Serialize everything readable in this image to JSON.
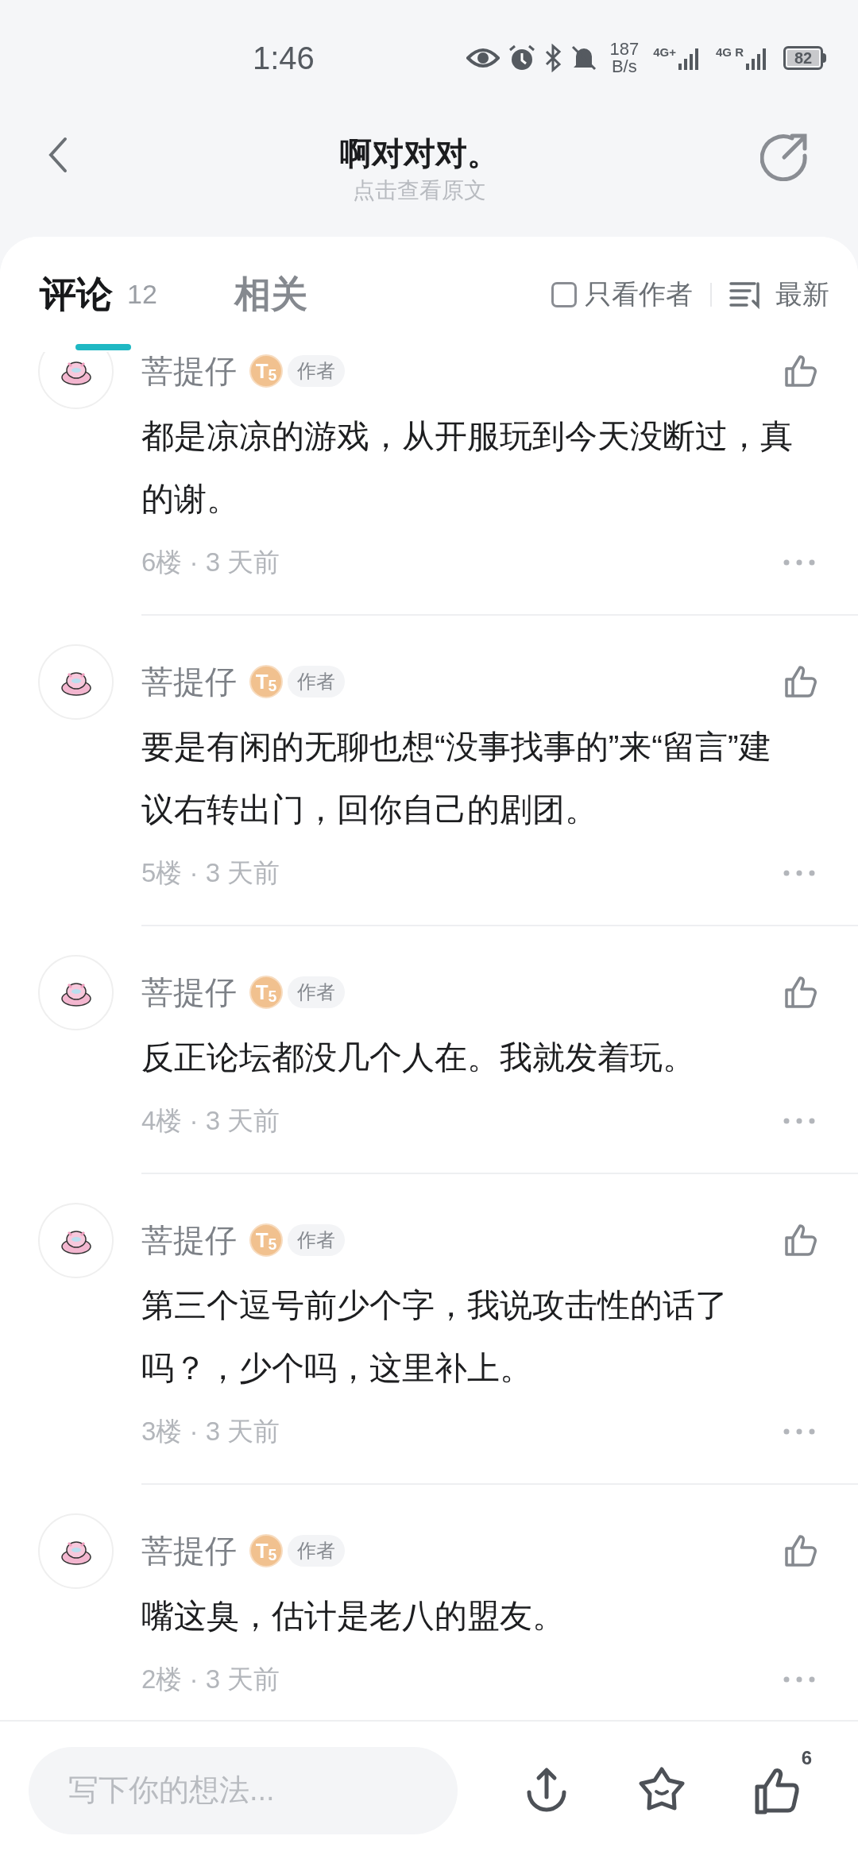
{
  "status_bar": {
    "time": "1:46",
    "net_speed": [
      "187",
      "B/s"
    ],
    "signals": [
      "4G+",
      "4G R"
    ],
    "battery": "82"
  },
  "header": {
    "title": "啊对对对。",
    "subtitle": "点击查看原文"
  },
  "tabs": [
    {
      "label": "评论",
      "count": "12",
      "selected": true
    },
    {
      "label": "相关",
      "selected": false
    }
  ],
  "author_only": {
    "label": "只看作者",
    "checked": false
  },
  "sort": {
    "label": "最新"
  },
  "comments": [
    {
      "author": "菩提仔",
      "rank_badge": "T$_{5}$",
      "role": "作者",
      "lines": [
        "都是凉凉的游戏，从开服玩到今天没断过，真",
        "的谢。"
      ],
      "meta": "6楼 · 3 天前"
    },
    {
      "author": "菩提仔",
      "rank_badge": "T$_{5}$",
      "role": "作者",
      "lines": [
        "要是有闲的无聊也想“没事找事的”来“留言”建",
        "议右转出门，回你自己的剧团。"
      ],
      "meta": "5楼 · 3 天前"
    },
    {
      "author": "菩提仔",
      "rank_badge": "T$_{5}$",
      "role": "作者",
      "lines": [
        "反正论坛都没几个人在。我就发着玩。"
      ],
      "meta": "4楼 · 3 天前"
    },
    {
      "author": "菩提仔",
      "rank_badge": "T$_{5}$",
      "role": "作者",
      "lines": [
        "第三个逗号前少个字，我说攻击性的话了",
        "吗？，少个吗，这里补上。"
      ],
      "meta": "3楼 · 3 天前"
    },
    {
      "author": "菩提仔",
      "rank_badge": "T$_{5}$",
      "role": "作者",
      "lines": [
        "嘴这臭，估计是老八的盟友。"
      ],
      "meta": "2楼 · 3 天前"
    }
  ],
  "composer": {
    "placeholder": "写下你的想法..."
  },
  "like_count": "6"
}
